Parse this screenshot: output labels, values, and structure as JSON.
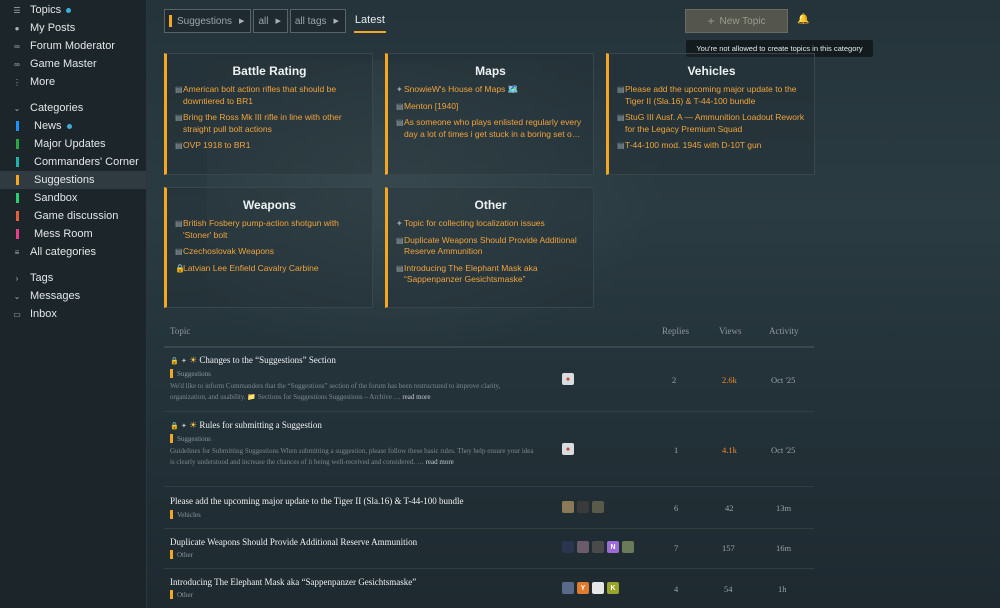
{
  "sidebar": {
    "top_items": [
      {
        "label": "Topics",
        "icon": "topics-icon",
        "dot": true
      },
      {
        "label": "My Posts",
        "icon": "user-icon",
        "dot": false
      },
      {
        "label": "Forum Moderator",
        "icon": "link-icon",
        "dot": false
      },
      {
        "label": "Game Master",
        "icon": "link-icon",
        "dot": false
      },
      {
        "label": "More",
        "icon": "more-icon",
        "dot": false
      }
    ],
    "categories_header": "Categories",
    "categories": [
      {
        "label": "News",
        "color": "#1e90ff",
        "dot": true
      },
      {
        "label": "Major Updates",
        "color": "#28a745",
        "dot": false
      },
      {
        "label": "Commanders' Corner",
        "color": "#20b2aa",
        "dot": false
      },
      {
        "label": "Suggestions",
        "color": "#f5a623",
        "dot": false,
        "active": true
      },
      {
        "label": "Sandbox",
        "color": "#2ecc71",
        "dot": false
      },
      {
        "label": "Game discussion",
        "color": "#e85d3a",
        "dot": false
      },
      {
        "label": "Mess Room",
        "color": "#e83e8c",
        "dot": false
      },
      {
        "label": "All categories",
        "color": "",
        "dot": false
      }
    ],
    "tags_header": "Tags",
    "messages_header": "Messages",
    "inbox": "Inbox"
  },
  "nav": {
    "category_dropdown": "Suggestions",
    "subcategory_dropdown": "all",
    "tags_dropdown": "all tags",
    "latest_tab": "Latest",
    "new_topic": "New Topic",
    "tooltip": "You're not allowed to create topics in this category"
  },
  "boxes": [
    {
      "title": "Battle Rating",
      "topics": [
        {
          "glyph": "doc",
          "text": "American bolt action rifles that should be downtiered to BR1"
        },
        {
          "glyph": "doc",
          "text": "Bring the Ross Mk III rifle in line with other straight pull bolt actions"
        },
        {
          "glyph": "doc",
          "text": "OVP 1918 to BR1"
        }
      ]
    },
    {
      "title": "Maps",
      "topics": [
        {
          "glyph": "pin",
          "text": "SnowieW's House of Maps 🗺️"
        },
        {
          "glyph": "doc",
          "text": "Menton [1940]"
        },
        {
          "glyph": "doc",
          "text": "As someone who plays enlisted regularly every day a lot of times i get stuck in a boring set o…"
        }
      ]
    },
    {
      "title": "Vehicles",
      "topics": [
        {
          "glyph": "doc",
          "text": "Please add the upcoming major update to the Tiger II (Sla.16) & T-44-100 bundle"
        },
        {
          "glyph": "doc",
          "text": "StuG III Ausf. A — Ammunition Loadout Rework for the Legacy Premium Squad"
        },
        {
          "glyph": "doc",
          "text": "T-44-100 mod. 1945 with D-10T gun"
        }
      ]
    },
    {
      "title": "Weapons",
      "topics": [
        {
          "glyph": "doc",
          "text": "British Fosbery pump-action shotgun with 'Stoner' bolt"
        },
        {
          "glyph": "doc",
          "text": "Czechoslovak Weapons"
        },
        {
          "glyph": "lock",
          "text": "Latvian Lee Enfield Cavalry Carbine"
        }
      ]
    },
    {
      "title": "Other",
      "topics": [
        {
          "glyph": "pin",
          "text": "Topic for collecting localization issues"
        },
        {
          "glyph": "doc",
          "text": "Duplicate Weapons Should Provide Additional Reserve Ammunition"
        },
        {
          "glyph": "doc",
          "text": "Introducing The Elephant Mask aka “Sappenpanzer Gesichtsmaske”"
        }
      ]
    }
  ],
  "table": {
    "headers": {
      "topic": "Topic",
      "replies": "Replies",
      "views": "Views",
      "activity": "Activity"
    },
    "rows": [
      {
        "title": "Changes to the “Suggestions” Section",
        "pinned": true,
        "category": "Suggestions",
        "excerpt": "We'd like to inform Commanders that the “Suggestions” section of the forum has been restructured to improve clarity, organization, and usability. 📁 Sections for Suggestions Suggestions – Archive …",
        "read_more": "read more",
        "replies": "2",
        "views": "2.6k",
        "views_hot": true,
        "activity": "Oct '25"
      },
      {
        "title": "Rules for submitting a Suggestion",
        "pinned": true,
        "category": "Suggestions",
        "excerpt": "Guidelines for Submitting Suggestions When submitting a suggestion, please follow these basic rules. They help ensure your idea is clearly understood and increase the chances of it being well-received and considered. …",
        "read_more": "read more",
        "replies": "1",
        "views": "4.1k",
        "views_hot": true,
        "activity": "Oct '25"
      },
      {
        "title": "Please add the upcoming major update to the Tiger II (Sla.16) & T-44-100 bundle",
        "pinned": false,
        "category": "Vehicles",
        "excerpt": "",
        "read_more": "",
        "replies": "6",
        "views": "42",
        "views_hot": false,
        "activity": "13m"
      },
      {
        "title": "Duplicate Weapons Should Provide Additional Reserve Ammunition",
        "pinned": false,
        "category": "Other",
        "excerpt": "",
        "read_more": "",
        "replies": "7",
        "views": "157",
        "views_hot": false,
        "activity": "16m"
      },
      {
        "title": "Introducing The Elephant Mask aka “Sappenpanzer Gesichtsmaske”",
        "pinned": false,
        "category": "Other",
        "excerpt": "",
        "read_more": "",
        "replies": "4",
        "views": "54",
        "views_hot": false,
        "activity": "1h"
      }
    ],
    "avatar_letters": {
      "n": "N",
      "y": "Y",
      "k": "K"
    }
  }
}
